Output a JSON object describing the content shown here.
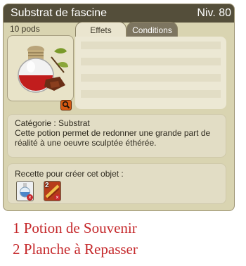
{
  "item": {
    "name": "Substrat de fascine",
    "level": "Niv. 80",
    "weight": "10 pods"
  },
  "tabs": [
    {
      "label": "Effets"
    },
    {
      "label": "Conditions"
    }
  ],
  "description": {
    "category": "Catégorie : Substrat",
    "text": "Cette potion permet de redonner une grande part de réalité à une oeuvre sculptée éthérée."
  },
  "recipe": {
    "label": "Recette pour créer cet objet :",
    "ingredients": [
      {
        "count": "",
        "icon": "potion-icon"
      },
      {
        "count": "2",
        "icon": "plank-icon"
      }
    ]
  },
  "legend": [
    "1 Potion de Souvenir",
    "2 Planche à Repasser"
  ],
  "colors": {
    "titlebar": "#544e3a",
    "panel": "#d9d4b1",
    "legend_text": "#c5282b"
  }
}
